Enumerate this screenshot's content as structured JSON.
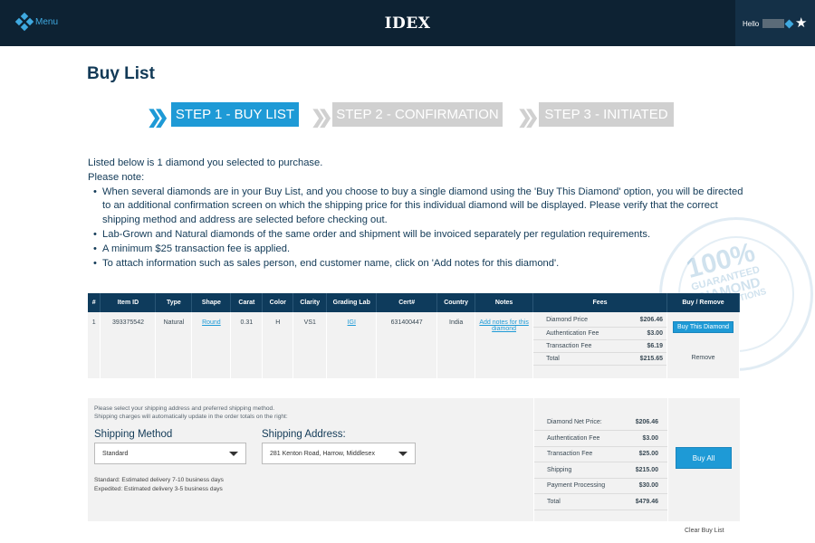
{
  "header": {
    "menu_label": "Menu",
    "logo": "IDEX",
    "greeting": "Hello"
  },
  "page_title": "Buy List",
  "steps": [
    {
      "label": "STEP 1 - BUY LIST",
      "active": true
    },
    {
      "label": "STEP 2 - CONFIRMATION",
      "active": false
    },
    {
      "label": "STEP 3 - INITIATED",
      "active": false
    }
  ],
  "intro": {
    "line1": "Listed below is 1 diamond you selected to purchase.",
    "line2": "Please note:",
    "bullets": [
      "When several diamonds are in your Buy List, and you choose to buy a single diamond using the 'Buy This Diamond' option, you will be directed to an additional confirmation screen on which the shipping price for this individual diamond will be displayed. Please verify that the correct shipping method and address are selected before checking out.",
      "Lab-Grown and Natural diamonds of the same order and shipment will be invoiced separately per regulation requirements.",
      "A minimum $25 transaction fee is applied.",
      "To attach information such as sales person, end customer name, click on 'Add notes for this diamond'."
    ]
  },
  "stamp": {
    "main": "100%",
    "line2": "GUARANTEED",
    "line3": "DIAMOND",
    "line4": "TRANSACTIONS"
  },
  "table": {
    "headers": [
      "#",
      "Item ID",
      "Type",
      "Shape",
      "Carat",
      "Color",
      "Clarity",
      "Grading Lab",
      "Cert#",
      "Country",
      "Notes",
      "Fees",
      "Buy / Remove"
    ],
    "row": {
      "num": "1",
      "item_id": "393375542",
      "type": "Natural",
      "shape": "Round",
      "carat": "0.31",
      "color": "H",
      "clarity": "VS1",
      "lab": "IGI",
      "cert": "631400447",
      "country": "India",
      "notes_link": "Add notes for this diamond",
      "fees": [
        {
          "label": "Diamond Price",
          "value": "$206.46"
        },
        {
          "label": "Authentication Fee",
          "value": "$3.00"
        },
        {
          "label": "Transaction Fee",
          "value": "$6.19"
        },
        {
          "label": "Total",
          "value": "$215.65"
        }
      ],
      "buy_button": "Buy This Diamond",
      "remove": "Remove"
    }
  },
  "shipping": {
    "note_line1": "Please select your shipping address and preferred shipping method.",
    "note_line2": "Shipping charges will automatically update in the order totals on the right:",
    "method_label": "Shipping Method",
    "method_value": "Standard",
    "address_label": "Shipping Address:",
    "address_value": "281 Kenton Road, Harrow, Middlesex",
    "delivery_standard": "Standard: Estimated delivery 7-10 business days",
    "delivery_expedited": "Expedited: Estimated delivery 3-5 business days"
  },
  "totals": [
    {
      "label": "Diamond Net Price:",
      "value": "$206.46"
    },
    {
      "label": "Authentication Fee",
      "value": "$3.00"
    },
    {
      "label": "Transaction Fee",
      "value": "$25.00"
    },
    {
      "label": "Shipping",
      "value": "$215.00"
    },
    {
      "label": "Payment Processing",
      "value": "$30.00"
    },
    {
      "label": "Total",
      "value": "$479.46"
    }
  ],
  "buy_all_label": "Buy All",
  "clear_label": "Clear Buy List",
  "colors": {
    "header_bg": "#0d2233",
    "accent": "#1e9ad6",
    "table_header": "#0e3b5c"
  }
}
